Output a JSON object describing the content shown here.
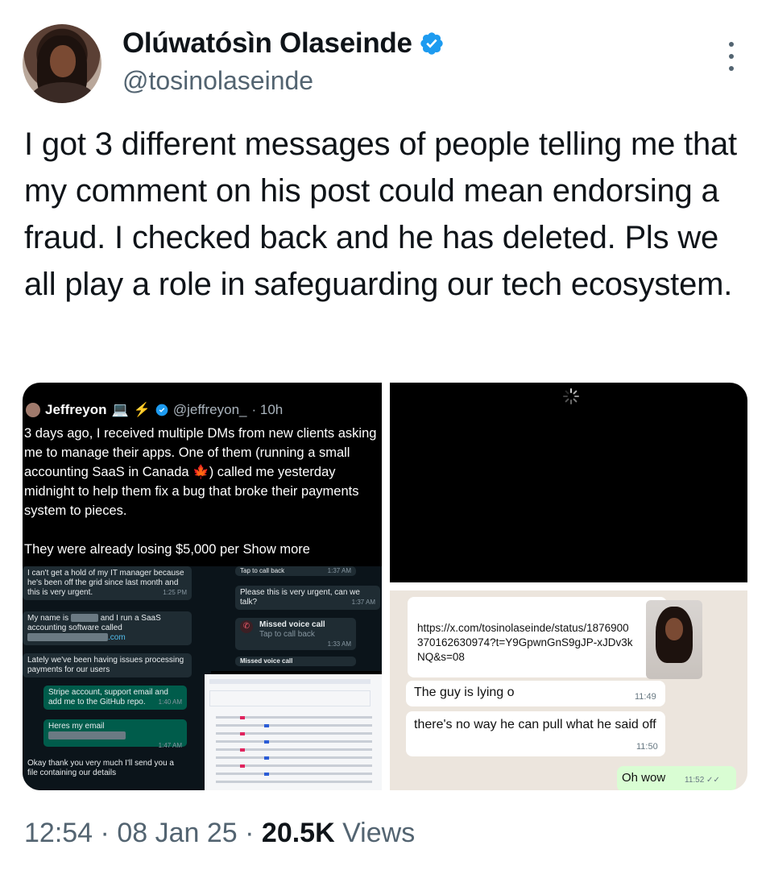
{
  "author": {
    "name": "Olúwatósìn Olaseinde",
    "handle": "@tosinolaseinde",
    "verified": true
  },
  "tweet": {
    "text": "I got 3 different messages of people telling me that my comment on his post could mean endorsing a fraud. I checked back and he has deleted. Pls we all play a role in safeguarding our tech ecosystem."
  },
  "media": {
    "embedded_post": {
      "name": "Jeffreyon",
      "handle": "@jeffreyon_",
      "time": "· 10h",
      "paragraph1": "3 days ago, I received multiple DMs from new clients asking me to manage their apps. One of them (running a small accounting SaaS in Canada 🍁) called me yesterday midnight to help them fix a bug that broke their payments system to pieces.",
      "paragraph2": "They were already losing $5,000 per Show more"
    },
    "whatsapp_left": {
      "msg1": "I can't get a hold of my IT manager because he's been off the grid since last month and this is very urgent.",
      "msg1_time": "1:25 PM",
      "msg2_a": "My name is",
      "msg2_b": "and I run a SaaS accounting software called",
      "msg2_c": ".com",
      "msg3": "Lately we've been having issues processing payments for our users",
      "msg4": "Stripe account, support email and add me to the GitHub repo.",
      "msg4_time": "1:40 AM",
      "msg5": "Heres my email",
      "msg5_time": "1:47 AM",
      "msg6": "Okay thank you very much I'll send you a file containing our details"
    },
    "whatsapp_mid": {
      "tap_back": "Tap to call back",
      "tap_back_time": "1:37 AM",
      "urgent": "Please this is very urgent, can we talk?",
      "urgent_time": "1:37 AM",
      "missed": "Missed voice call",
      "missed_sub": "Tap to call back",
      "missed_time": "1:33 AM",
      "missed2": "Missed voice call"
    },
    "chat_right": {
      "link": "https://x.com/tosinolaseinde/status/1876900370162630974?t=Y9GpwnGnS9gJP-xJDv3kNQ&s=08",
      "msg1": "The guy is lying o",
      "msg1_time": "11:49",
      "msg2": "there's no way he can pull what he said off",
      "msg2_time": "11:50",
      "msg3": "Oh wow",
      "msg3_time": "11:52 ✓✓"
    }
  },
  "footer": {
    "time": "12:54",
    "date": "08 Jan 25",
    "views_count": "20.5K",
    "views_label": "Views"
  }
}
